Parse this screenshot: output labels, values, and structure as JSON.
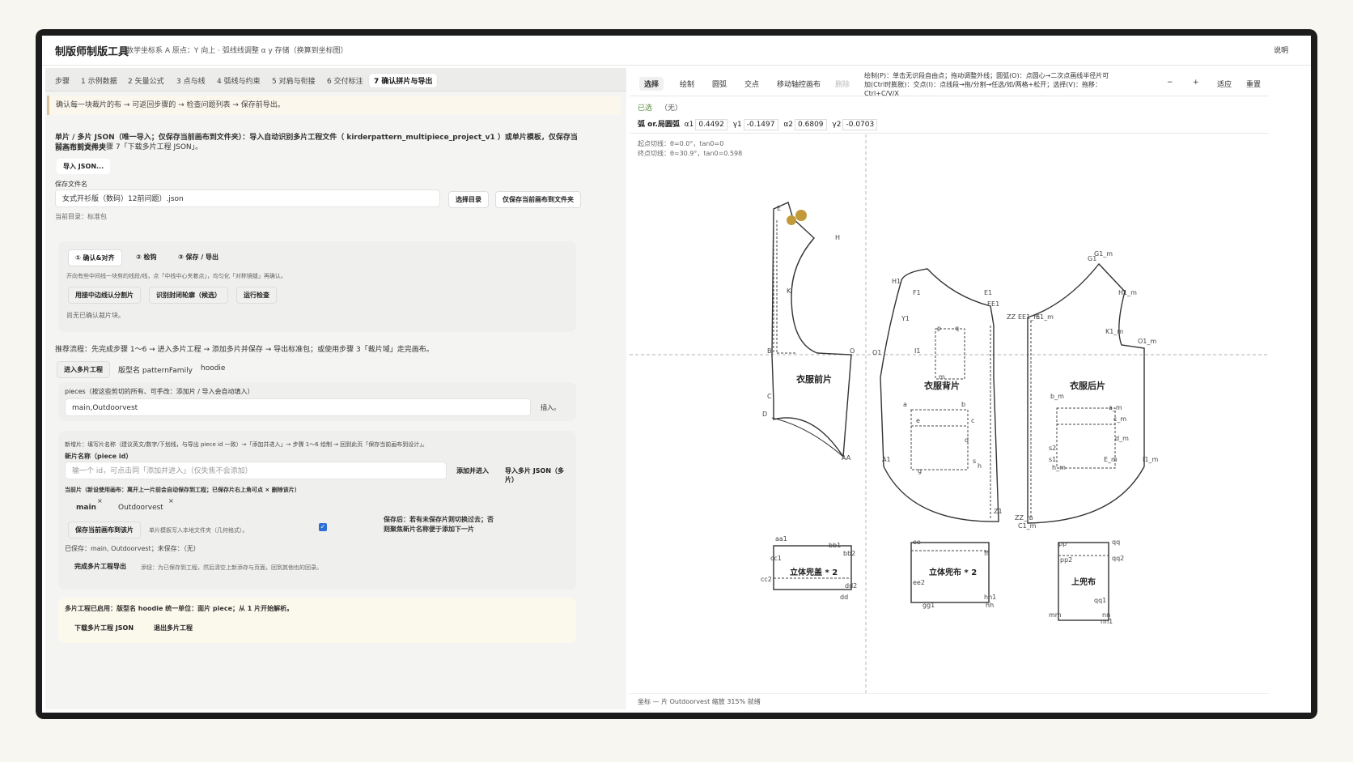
{
  "app": {
    "title": "制版师制版工具",
    "subtitle": "数学坐标系 A 原点：Y 向上 · 弧线线调整 α y 存储（换算到坐标图）",
    "help": "说明"
  },
  "tabs": [
    "步骤",
    "1 示例数据",
    "2 矢量公式",
    "3 点与线",
    "4 弧线与约束",
    "5 对肩与衔接",
    "6 交付标注",
    "7 确认拼片与导出"
  ],
  "notice": "确认每一块裁片的布 → 可返回步骤的 → 检查问题列表 → 保存前导出。",
  "json_section": {
    "intro": "单片 / 多片 JSON（唯一导入；仅保存当前画布到文件夹）：导入自动识别多片工程文件（ kirderpattern_multipiece_project_v1 ）或单片模板，仅保存当前画布到文件夹",
    "intro2": "写入当前调用步骤 7「下载多片工程 JSON」。",
    "import_btn": "导入 JSON...",
    "filename_label": "保存文件名",
    "filename_value": "女式开衫版（数码）12前问题）.json",
    "choose_dir": "选择目录",
    "save_folder": "仅保存当前画布到文件夹",
    "current_dir": "当前目录：标准包"
  },
  "confirm_card": {
    "steps": [
      "① 确认&对齐",
      "② 检钩",
      "③ 保存 / 导出"
    ],
    "hint": "开向有些中间线一块剪的线段/线，点「中线中心夹着点」，均匀化「对称镜缝」再确认。",
    "btn_split": "用接中边线认分割片",
    "btn_detect": "识别封闭轮廓（候选）",
    "btn_check": "运行检查",
    "no_piece": "尚无已确认裁片块。"
  },
  "flow": {
    "text": "推荐流程：先完成步骤 1～6 → 进入多片工程 → 添加多片并保存 → 导出标准包；或使用步骤 3「裁片域」走完画布。",
    "enter_btn": "进入多片工程",
    "family_label": "版型名 patternFamily",
    "family_value": "hoodie"
  },
  "pieces_card": {
    "label": "pieces（按这些剪切的所有、可手改：添加片 / 导入会自动填入）",
    "value": "main,Outdoorvest",
    "insert": "插入。"
  },
  "new_piece": {
    "hint": "新增片：填写片名称（建议英文/数字/下划线，与导出 piece id 一致）→「添加并进入」→ 步骤 1～6 绘制 → 回到此页「保存当前画布到设计」。",
    "name_label": "新片名称（piece id）",
    "name_placeholder": "输一个 id，可点击同「添加并进入」（仅失焦不会添加）",
    "add_btn": "添加并进入",
    "import_btn": "导入多片 JSON（多片）",
    "current_label": "当前片（新设使用画布：离开上一片前会自动保存到工程；已保存片右上角可点 × 删除该片）",
    "chips": [
      "main",
      "Outdoorvest"
    ],
    "save_btn": "保存当前画布到该片",
    "tpl_hint": "单片模板写入本地文件夹（几何格式）。",
    "warn": "保存后：若有未保存片则切换过去；否则聚焦新片名称便于添加下一片",
    "saved_line": "已保存：main, Outdoorvest；未保存：（无）",
    "finish_btn": "完成多片工程导出",
    "finish_hint": "添钮：为已保存到工程，然后清空上新添存与页面，回到其他也的回录。"
  },
  "multi": {
    "text": "多片工程已启用：版型名 hoodie  统一单位：面片 piece；从 1 片开始解析。",
    "download": "下载多片工程 JSON",
    "exit": "退出多片工程"
  },
  "toolbar": {
    "tools": [
      "选择",
      "绘制",
      "圆弧",
      "交点",
      "移动轴控画布",
      "删除"
    ],
    "help": "绘制(P)：单击无识段自由点；拖动调整外线；圆弧(O)：点圆心→二次点画线半径片可加(Ctrl时膨胀)：交点(I)：点线段→拖/分割→任选/如/两格+松开；选择(V)：拖移：Ctrl+C/V/X",
    "zoom_out": "−",
    "zoom_in": "+",
    "fit": "适应",
    "reset": "重置"
  },
  "status": {
    "selected_label": "已选",
    "selected_value": "（无）"
  },
  "arc": {
    "label": "弧 or.局圆弧",
    "a1_label": "α1",
    "a1": "0.4492",
    "y1_label": "γ1",
    "y1": "-0.1497",
    "a2_label": "α2",
    "a2": "0.6809",
    "y2_label": "γ2",
    "y2": "-0.0703"
  },
  "canvas": {
    "info1": "起点切线：θ=0.0°，tan0=0",
    "info2": "终点切线：θ=30.9°，tan0=0.598",
    "pieces": {
      "front": "衣服前片",
      "back": "衣服背片",
      "back2": "衣服后片",
      "pocket1": "立体兜盖 * 2",
      "pocket2": "立体兜布 * 2",
      "pocket3": "上兜布"
    },
    "point_labels": [
      "E",
      "H",
      "K",
      "B",
      "C",
      "D",
      "O",
      "AA",
      "G1",
      "H1",
      "F1",
      "E1",
      "EE1",
      "Y1",
      "I1",
      "p",
      "q",
      "m",
      "a",
      "b",
      "c",
      "d",
      "e",
      "g",
      "h",
      "s",
      "A1",
      "Z1",
      "ZZ",
      "O1",
      "G1_m",
      "H1_m",
      "K1_m",
      "O1_m",
      "EE1_m",
      "E1_m",
      "b_m",
      "a_m",
      "c_m",
      "d_m",
      "s1",
      "s2",
      "h_m",
      "E_m",
      "I1_m",
      "ZZ_m",
      "C1_m",
      "aa1",
      "bb1",
      "bb2",
      "cc1",
      "cc2",
      "dd",
      "dd2",
      "ee",
      "ee2",
      "ff",
      "gg1",
      "hh",
      "hh1",
      "pp",
      "pp2",
      "qq",
      "qq2",
      "qq1",
      "mm",
      "nn",
      "nn1"
    ]
  },
  "footer": {
    "text": "坐标  — 片 Outdoorvest  缩放 315%  就绪"
  }
}
